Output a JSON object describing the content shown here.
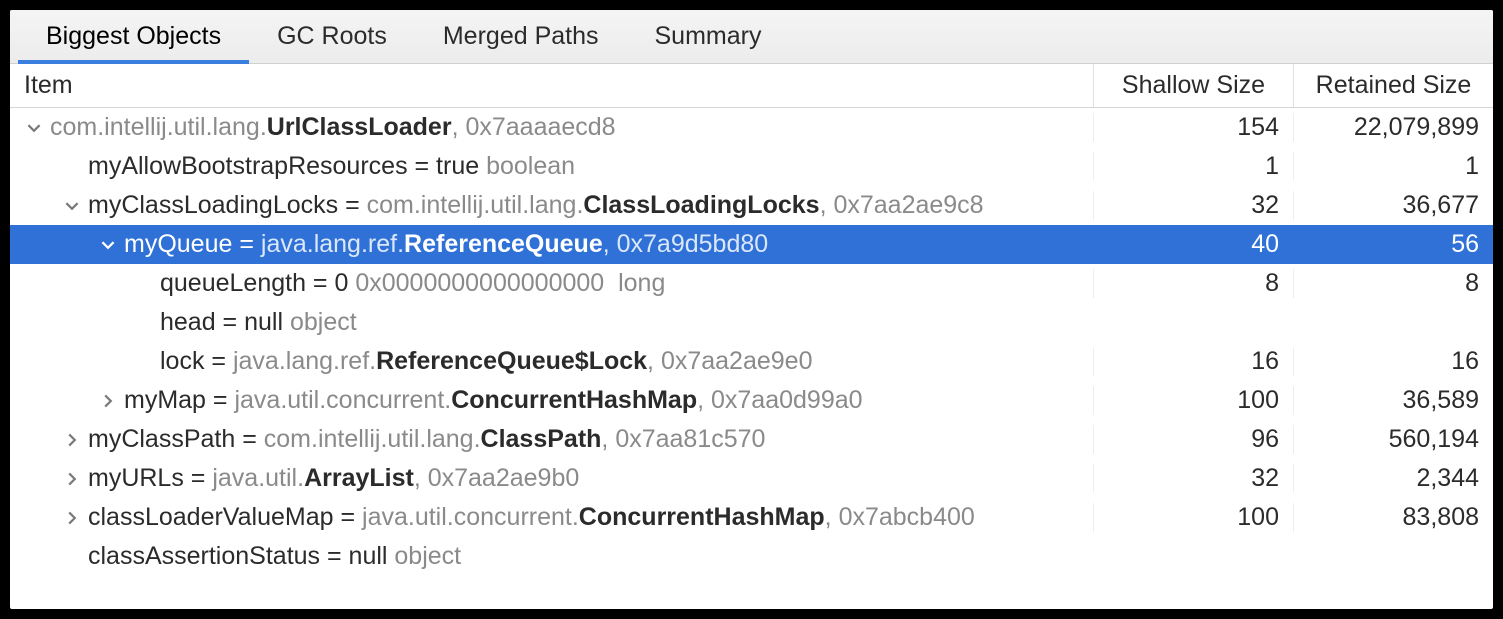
{
  "tabs": {
    "biggest": "Biggest Objects",
    "gcroots": "GC Roots",
    "merged": "Merged Paths",
    "summary": "Summary"
  },
  "columns": {
    "item": "Item",
    "shallow": "Shallow Size",
    "retained": "Retained Size"
  },
  "rows": [
    {
      "indent": 0,
      "chev": "down",
      "selected": false,
      "segs": [
        {
          "t": "com.intellij.util.lang.",
          "cls": "gray"
        },
        {
          "t": "UrlClassLoader",
          "cls": "bold"
        },
        {
          "t": ", 0x7aaaaecd8",
          "cls": "gray"
        }
      ],
      "shallow": "154",
      "retained": "22,079,899"
    },
    {
      "indent": 1,
      "chev": "none",
      "selected": false,
      "segs": [
        {
          "t": "myAllowBootstrapResources = true ",
          "cls": ""
        },
        {
          "t": "boolean",
          "cls": "gray"
        }
      ],
      "shallow": "1",
      "retained": "1"
    },
    {
      "indent": 1,
      "chev": "down",
      "selected": false,
      "segs": [
        {
          "t": "myClassLoadingLocks = ",
          "cls": ""
        },
        {
          "t": "com.intellij.util.lang.",
          "cls": "gray"
        },
        {
          "t": "ClassLoadingLocks",
          "cls": "bold"
        },
        {
          "t": ", 0x7aa2ae9c8",
          "cls": "gray"
        }
      ],
      "shallow": "32",
      "retained": "36,677"
    },
    {
      "indent": 2,
      "chev": "down",
      "selected": true,
      "segs": [
        {
          "t": "myQueue = ",
          "cls": ""
        },
        {
          "t": "java.lang.ref.",
          "cls": "gray"
        },
        {
          "t": "ReferenceQueue",
          "cls": "bold"
        },
        {
          "t": ", 0x7a9d5bd80",
          "cls": "gray"
        }
      ],
      "shallow": "40",
      "retained": "56"
    },
    {
      "indent": 3,
      "chev": "none",
      "selected": false,
      "segs": [
        {
          "t": "queueLength = 0 ",
          "cls": ""
        },
        {
          "t": "0x0000000000000000  long",
          "cls": "gray"
        }
      ],
      "shallow": "8",
      "retained": "8"
    },
    {
      "indent": 3,
      "chev": "none",
      "selected": false,
      "segs": [
        {
          "t": "head = null ",
          "cls": ""
        },
        {
          "t": "object",
          "cls": "gray"
        }
      ],
      "shallow": "",
      "retained": ""
    },
    {
      "indent": 3,
      "chev": "none",
      "selected": false,
      "segs": [
        {
          "t": "lock = ",
          "cls": ""
        },
        {
          "t": "java.lang.ref.",
          "cls": "gray"
        },
        {
          "t": "ReferenceQueue$Lock",
          "cls": "bold"
        },
        {
          "t": ", 0x7aa2ae9e0",
          "cls": "gray"
        }
      ],
      "shallow": "16",
      "retained": "16"
    },
    {
      "indent": 2,
      "chev": "right",
      "selected": false,
      "segs": [
        {
          "t": "myMap = ",
          "cls": ""
        },
        {
          "t": "java.util.concurrent.",
          "cls": "gray"
        },
        {
          "t": "ConcurrentHashMap",
          "cls": "bold"
        },
        {
          "t": ", 0x7aa0d99a0",
          "cls": "gray"
        }
      ],
      "shallow": "100",
      "retained": "36,589"
    },
    {
      "indent": 1,
      "chev": "right",
      "selected": false,
      "segs": [
        {
          "t": "myClassPath = ",
          "cls": ""
        },
        {
          "t": "com.intellij.util.lang.",
          "cls": "gray"
        },
        {
          "t": "ClassPath",
          "cls": "bold"
        },
        {
          "t": ", 0x7aa81c570",
          "cls": "gray"
        }
      ],
      "shallow": "96",
      "retained": "560,194"
    },
    {
      "indent": 1,
      "chev": "right",
      "selected": false,
      "segs": [
        {
          "t": "myURLs = ",
          "cls": ""
        },
        {
          "t": "java.util.",
          "cls": "gray"
        },
        {
          "t": "ArrayList",
          "cls": "bold"
        },
        {
          "t": ", 0x7aa2ae9b0",
          "cls": "gray"
        }
      ],
      "shallow": "32",
      "retained": "2,344"
    },
    {
      "indent": 1,
      "chev": "right",
      "selected": false,
      "segs": [
        {
          "t": "classLoaderValueMap = ",
          "cls": ""
        },
        {
          "t": "java.util.concurrent.",
          "cls": "gray"
        },
        {
          "t": "ConcurrentHashMap",
          "cls": "bold"
        },
        {
          "t": ", 0x7abcb400",
          "cls": "gray"
        }
      ],
      "shallow": "100",
      "retained": "83,808"
    },
    {
      "indent": 1,
      "chev": "none",
      "selected": false,
      "segs": [
        {
          "t": "classAssertionStatus = null ",
          "cls": ""
        },
        {
          "t": "object",
          "cls": "gray"
        }
      ],
      "shallow": "",
      "retained": ""
    }
  ]
}
